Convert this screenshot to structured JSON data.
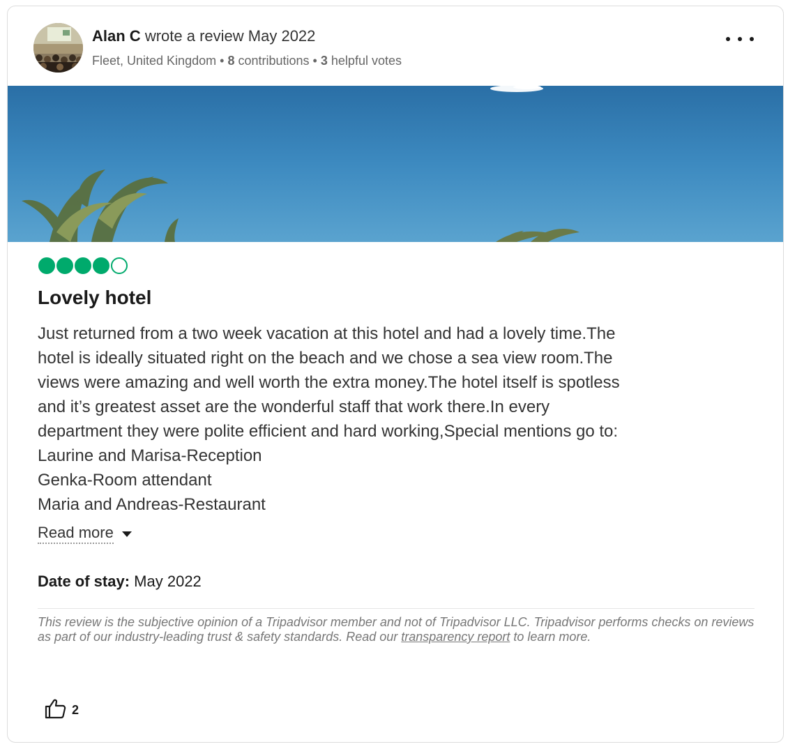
{
  "review": {
    "author": "Alan C",
    "action": "wrote a review",
    "date": "May 2022",
    "location": "Fleet, United Kingdom",
    "contributions_count": "8",
    "contributions_label": "contributions",
    "helpful_votes_count": "3",
    "helpful_votes_label": "helpful votes",
    "separator": "•",
    "rating": 4,
    "rating_max": 5,
    "title": "Lovely hotel",
    "body_lines": [
      "Just returned from a two week vacation at this hotel and had a lovely time.The",
      "hotel is ideally situated right on the beach and we chose a sea view room.The",
      "views were amazing and well worth the extra money.The hotel itself is spotless",
      "and it’s greatest asset are the wonderful staff that work there.In every",
      "department they were polite efficient and hard working,Special mentions go to:",
      "Laurine and Marisa-Reception",
      "Genka-Room attendant",
      "Maria and Andreas-Restaurant"
    ],
    "read_more": "Read more",
    "date_of_stay_label": "Date of stay:",
    "date_of_stay": "May 2022",
    "disclaimer_before": "This review is the subjective opinion of a Tripadvisor member and not of Tripadvisor LLC. Tripadvisor performs checks on reviews as part of our industry-leading trust & safety standards. Read our ",
    "disclaimer_link": "transparency report",
    "disclaimer_after": " to learn more.",
    "helpful_count": "2"
  },
  "icons": {
    "more": "more-options-icon",
    "helpful": "thumbs-up-icon",
    "read_more": "caret-down-icon"
  },
  "colors": {
    "rating_green": "#00aa6c",
    "text_primary": "#1a1a1a",
    "text_secondary": "#666666"
  }
}
